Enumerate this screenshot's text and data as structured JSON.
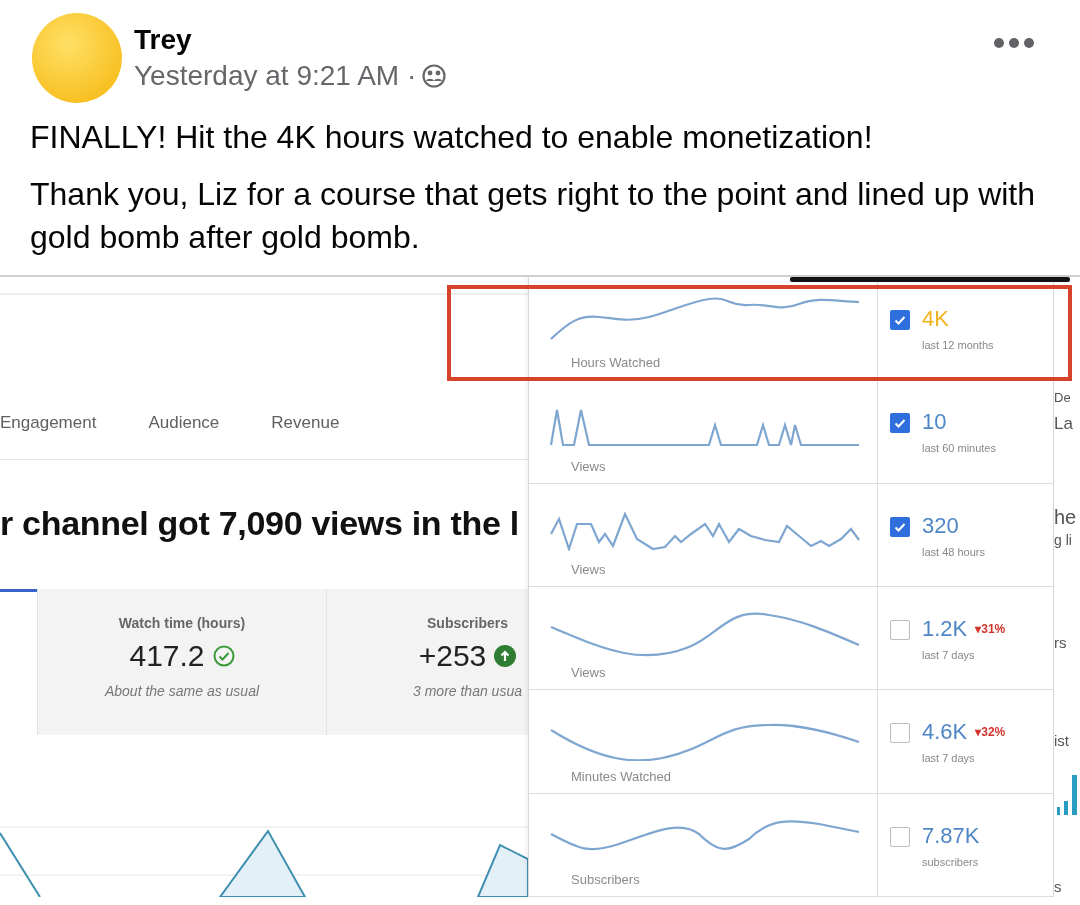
{
  "post": {
    "author": "Trey",
    "time": "Yesterday at 9:21 AM ·",
    "paragraphs": [
      "FINALLY! Hit the 4K hours watched to enable monetization!",
      "Thank you, Liz for a course that gets right to the point and lined up with gold bomb after gold bomb."
    ]
  },
  "analytics": {
    "tabs": [
      {
        "label": "Engagement",
        "selected": false
      },
      {
        "label": "Audience",
        "selected": false
      },
      {
        "label": "Revenue",
        "selected": false
      }
    ],
    "headline": "r channel got 7,090 views in the l",
    "cards": [
      {
        "label": "Watch time (hours)",
        "value": "417.2",
        "kind": "check",
        "note": "About the same as usual"
      },
      {
        "label": "Subscribers",
        "value": "+253",
        "kind": "up",
        "note": "3 more than usua"
      }
    ]
  },
  "metrics": [
    {
      "label": "Hours Watched",
      "checked": true,
      "value": "4K",
      "color": "#f2b21b",
      "period": "last 12 months"
    },
    {
      "label": "Views",
      "checked": true,
      "value": "10",
      "color": "#4f86c6",
      "period": "last 60 minutes"
    },
    {
      "label": "Views",
      "checked": true,
      "value": "320",
      "color": "#4f86c6",
      "period": "last 48 hours"
    },
    {
      "label": "Views",
      "checked": false,
      "value": "1.2K",
      "color": "#4f86c6",
      "delta": "▾31%",
      "period": "last 7 days"
    },
    {
      "label": "Minutes Watched",
      "checked": false,
      "value": "4.6K",
      "color": "#4f86c6",
      "delta": "▾32%",
      "period": "last 7 days"
    },
    {
      "label": "Subscribers",
      "checked": false,
      "value": "7.87K",
      "color": "#4f86c6",
      "period": "subscribers"
    }
  ],
  "edge_fragments": [
    "De",
    "La",
    "he",
    "g li",
    "rs",
    "ist",
    "s"
  ]
}
